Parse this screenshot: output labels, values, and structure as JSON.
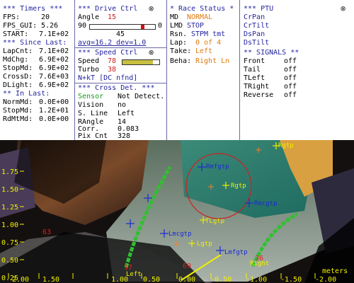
{
  "timers": {
    "title": "*** Timers ***",
    "fps_label": "FPS:",
    "fps": "20",
    "fps_gui_label": "FPS_GUI:",
    "fps_gui": "5.26",
    "start_label": "START:",
    "start": "7.1E+02",
    "since_last_title": "*** Since Last:",
    "lapcnt_label": "LapCnt:",
    "lapcnt": "7.1E+02",
    "mdchg_label": "MdChg:",
    "mdchg": "6.9E+02",
    "stopmd_label": "StopMd:",
    "stopmd": "6.9E+02",
    "crossd_label": "CrossD:",
    "crossd": "7.6E+03",
    "dlight_label": "DLight:",
    "dlight": "6.9E+02",
    "in_last_title": "** In Last:",
    "normmd_label": "NormMd:",
    "normmd": "0.0E+00",
    "stopmd2_label": "StopMd:",
    "stopmd2": "1.2E+01",
    "rdmtmd_label": "RdMtMd:",
    "rdmtmd": "0.0E+00"
  },
  "drive": {
    "title": "*** Drive Ctrl",
    "angle_label": "Angle",
    "angle": "15",
    "slider_min": "90",
    "slider_max": "0",
    "slider_level": 0.83,
    "slider_mid": "45",
    "avg_dev": "avg=16.2 dev=1.0",
    "speed_title": "*** Speed Ctrl",
    "speed_label": "Speed",
    "speed": "78",
    "speed_level": 0.82,
    "turbo_label": "Turbo",
    "turbo": "38",
    "nkt": "N+kT [DC nfnd]",
    "cross_title": "*** Cross Det. ***",
    "sensor_label": "Sensor",
    "sensor": "Not Detect.",
    "vision_label": "Vision",
    "vision": "no",
    "sline_label": "S. Line",
    "sline": "Left",
    "rangle_label": "RAngle",
    "rangle": "14",
    "corr_label": "Corr.",
    "corr": "0.083",
    "pixcnt_label": "Pix Cnt",
    "pixcnt": "328"
  },
  "race": {
    "title": "* Race Status *",
    "md_label": "MD",
    "md": "NORMAL",
    "lmd_label": "LMD",
    "lmd": "STOP",
    "rsn_label": "Rsn.",
    "rsn": "STPM tmt",
    "lap_label": "Lap:",
    "lap": "0 of 4",
    "take_label": "Take:",
    "take": "Left",
    "beha_label": "Beha:",
    "beha": "Right Ln"
  },
  "ptu": {
    "title": "*** PTU",
    "items": [
      "CrPan",
      "CrTilt",
      "DsPan",
      "DsTilt"
    ],
    "signals_title": "** SIGNALS **",
    "signals": [
      {
        "name": "Front",
        "value": "off"
      },
      {
        "name": "Tail",
        "value": "off"
      },
      {
        "name": "TLeft",
        "value": "off"
      },
      {
        "name": "TRight",
        "value": "off"
      },
      {
        "name": "Reverse",
        "value": "off"
      }
    ]
  },
  "view": {
    "y_ticks": [
      "1.75",
      "1.50",
      "1.25",
      "1.00",
      "0.75",
      "0.50",
      "0.25",
      "0.00"
    ],
    "x_ticks": [
      "2.00",
      "1.50",
      "1.00",
      "0.50",
      "0.00",
      "-0.50",
      "-1.00",
      "-1.50",
      "-2.00"
    ],
    "units": "meters",
    "labels": {
      "rgtp_top": "Rgtp",
      "rmfgtp": "Rmfgtp",
      "rgtp": "Rgtp",
      "rmcgtp": "Rmcgtp",
      "tlgtp": "TLgtp",
      "lmcgtp": "Lmcgtp",
      "lgtp": "Lgtp",
      "lmfgtp": "Lmfgtp",
      "right": "Right",
      "left": "Left",
      "n63": "63",
      "n17": "17",
      "n69": "69",
      "n36": "36"
    }
  }
}
